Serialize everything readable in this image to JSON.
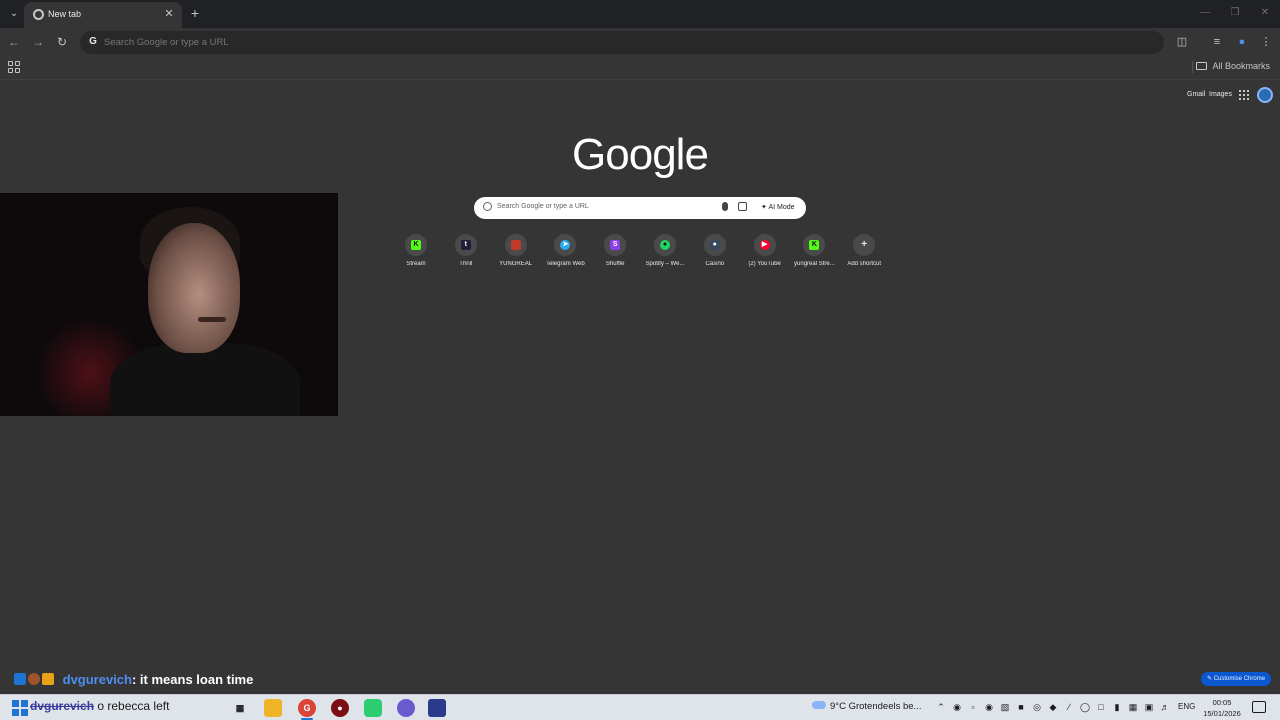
{
  "browser": {
    "tab_title": "New tab",
    "omnibox_placeholder": "Search Google or type a URL",
    "bookmarks_label": "All Bookmarks"
  },
  "ntp": {
    "top_links": [
      "Gmail",
      "Images"
    ],
    "logo_text": "Google",
    "search_placeholder": "Search Google or type a URL",
    "ai_mode_label": "AI Mode",
    "shortcuts": [
      {
        "label": "Stream",
        "icon": "kick-icon",
        "color": "#53fc18"
      },
      {
        "label": "Thrill",
        "icon": "thrill-icon",
        "color": "#1f1f3a"
      },
      {
        "label": "YUNGREAL",
        "icon": "yungreal-icon",
        "color": "#c0392b"
      },
      {
        "label": "Telegram Web",
        "icon": "telegram-icon",
        "color": "#2aabee"
      },
      {
        "label": "Shuffle",
        "icon": "shuffle-icon",
        "color": "#8b3ee6"
      },
      {
        "label": "Spotify – We...",
        "icon": "spotify-icon",
        "color": "#1ed760"
      },
      {
        "label": "Casino",
        "icon": "casino-icon",
        "color": "#3a4a5c"
      },
      {
        "label": "(2) YouTube",
        "icon": "youtube-icon",
        "color": "#ff0033"
      },
      {
        "label": "yungreal Stre...",
        "icon": "kick-icon",
        "color": "#53fc18"
      },
      {
        "label": "Add shortcut",
        "icon": "plus-icon",
        "color": "#e8eaed"
      }
    ],
    "customise_label": "Customise Chrome"
  },
  "overlay": {
    "chat_user": "dvgurevich",
    "chat_message": ": it means loan time",
    "stream_text_name": "dvgurevich",
    "stream_text_rest": "o rebecca left"
  },
  "taskbar": {
    "weather": "9°C  Grotendeels be...",
    "language": "ENG",
    "time": "00:05",
    "date": "15/01/2026"
  }
}
